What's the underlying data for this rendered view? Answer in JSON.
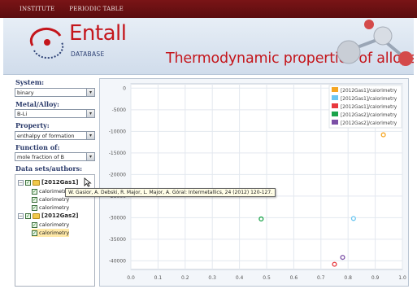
{
  "nav": {
    "institute": "INSTITUTE",
    "periodic_table": "PERIODIC TABLE"
  },
  "brand": {
    "logo_text": "Entall",
    "logo_sub": "DATABASE"
  },
  "header": {
    "title": "Thermodynamic properties of alloys"
  },
  "sidebar": {
    "system_label": "System:",
    "system_value": "binary",
    "metal_label": "Metal/Alloy:",
    "metal_value": "B-Li",
    "property_label": "Property:",
    "property_value": "enthalpy of formation",
    "function_label": "Function of:",
    "function_value": "mole fraction of B",
    "datasets_label": "Data sets/authors:",
    "tree": [
      {
        "label": "[2012Gas1]",
        "children": [
          "calorimetry",
          "calorimetry",
          "calorimetry"
        ]
      },
      {
        "label": "[2012Gas2]",
        "children": [
          "calorimetry",
          "calorimetry"
        ]
      }
    ]
  },
  "tooltip": "W. Gasior, A. Debski, R. Major, L. Major, A. Góral: Intermetallics, 24 (2012) 120-127.",
  "chart_data": {
    "type": "scatter",
    "xlim": [
      0.0,
      1.0
    ],
    "ylim": [
      -42000,
      1000
    ],
    "x_ticks": [
      "0.0",
      "0.1",
      "0.2",
      "0.3",
      "0.4",
      "0.5",
      "0.6",
      "0.7",
      "0.8",
      "0.9",
      "1.0"
    ],
    "y_ticks": [
      "0",
      "-5000",
      "-10000",
      "-15000",
      "-20000",
      "-25000",
      "-30000",
      "-35000",
      "-40000"
    ],
    "grid": true,
    "legend_position": "top-right",
    "series": [
      {
        "name": "[2012Gas1]/calorimetry",
        "color": "#f5a623",
        "points": [
          [
            0.93,
            -10800
          ]
        ]
      },
      {
        "name": "[2012Gas1]/calorimetry",
        "color": "#6cc6f0",
        "points": [
          [
            0.82,
            -30200
          ]
        ]
      },
      {
        "name": "[2012Gas1]/calorimetry",
        "color": "#e8383d",
        "points": [
          [
            0.75,
            -40800
          ]
        ]
      },
      {
        "name": "[2012Gas2]/calorimetry",
        "color": "#1aa34a",
        "points": [
          [
            0.48,
            -30300
          ]
        ]
      },
      {
        "name": "[2012Gas2]/calorimetry",
        "color": "#7b4fa6",
        "points": [
          [
            0.78,
            -39200
          ]
        ]
      }
    ]
  }
}
